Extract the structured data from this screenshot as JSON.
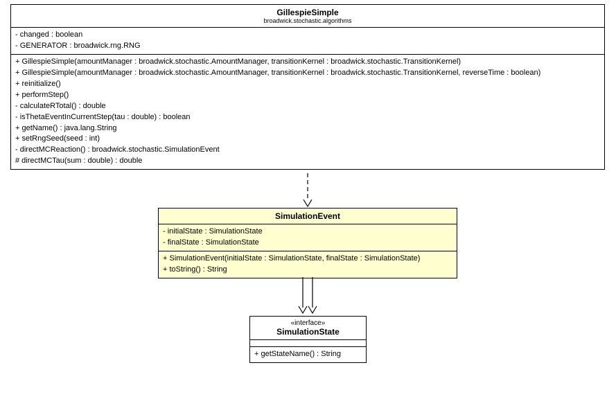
{
  "classes": {
    "gillespie": {
      "name": "GillespieSimple",
      "package": "broadwick.stochastic.algorithms",
      "attributes": [
        "- changed : boolean",
        "- GENERATOR : broadwick.rng.RNG"
      ],
      "operations": [
        "+ GillespieSimple(amountManager : broadwick.stochastic.AmountManager, transitionKernel : broadwick.stochastic.TransitionKernel)",
        "+ GillespieSimple(amountManager : broadwick.stochastic.AmountManager, transitionKernel : broadwick.stochastic.TransitionKernel, reverseTime : boolean)",
        "+ reinitialize()",
        "+ performStep()",
        "- calculateRTotal() : double",
        "- isThetaEventInCurrentStep(tau : double) : boolean",
        "+ getName() : java.lang.String",
        "+ setRngSeed(seed : int)",
        "- directMCReaction() : broadwick.stochastic.SimulationEvent",
        "# directMCTau(sum : double) : double"
      ]
    },
    "simevent": {
      "name": "SimulationEvent",
      "attributes": [
        "- initialState : SimulationState",
        "- finalState : SimulationState"
      ],
      "operations": [
        "+ SimulationEvent(initialState : SimulationState, finalState : SimulationState)",
        "+ toString() : String"
      ]
    },
    "simstate": {
      "stereotype": "«interface»",
      "name": "SimulationState",
      "operations": [
        "+ getStateName() : String"
      ]
    }
  }
}
